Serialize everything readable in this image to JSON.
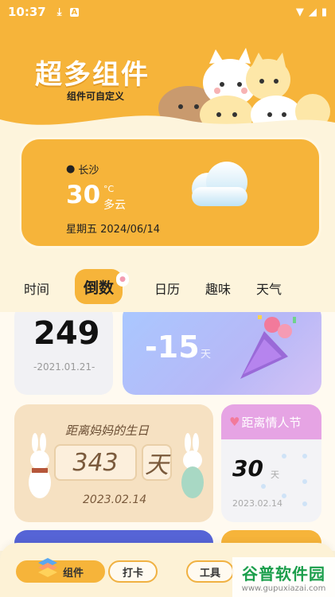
{
  "status_bar": {
    "time": "10:37",
    "download_icon": "download-icon",
    "app_icon": "A"
  },
  "banner": {
    "title": "超多组件",
    "subtitle": "组件可自定义"
  },
  "weather": {
    "location": "长沙",
    "temperature": "30",
    "unit": "°C",
    "condition": "多云",
    "date": "星期五 2024/06/14"
  },
  "tabs": [
    "时间",
    "倒数",
    "日历",
    "趣味",
    "天气"
  ],
  "active_tab": "倒数",
  "cards": {
    "count_up": {
      "value": "249",
      "date": "-2021.01.21-"
    },
    "countdown_gradient": {
      "value": "-15",
      "unit": "天"
    },
    "mom_birthday": {
      "title": "距离妈妈的生日",
      "value": "343",
      "unit": "天",
      "date": "2023.02.14"
    },
    "valentine": {
      "title": "距离情人节",
      "value": "30",
      "unit": "天",
      "date": "2023.02.14"
    }
  },
  "bottom_nav": [
    "组件",
    "打卡",
    "工具"
  ],
  "watermark": {
    "text": "谷普软件园",
    "url": "www.gupuxiazai.com"
  },
  "colors": {
    "accent": "#f6b43a",
    "background": "#fdf4dc",
    "valentine_header": "#e6a4e4"
  }
}
